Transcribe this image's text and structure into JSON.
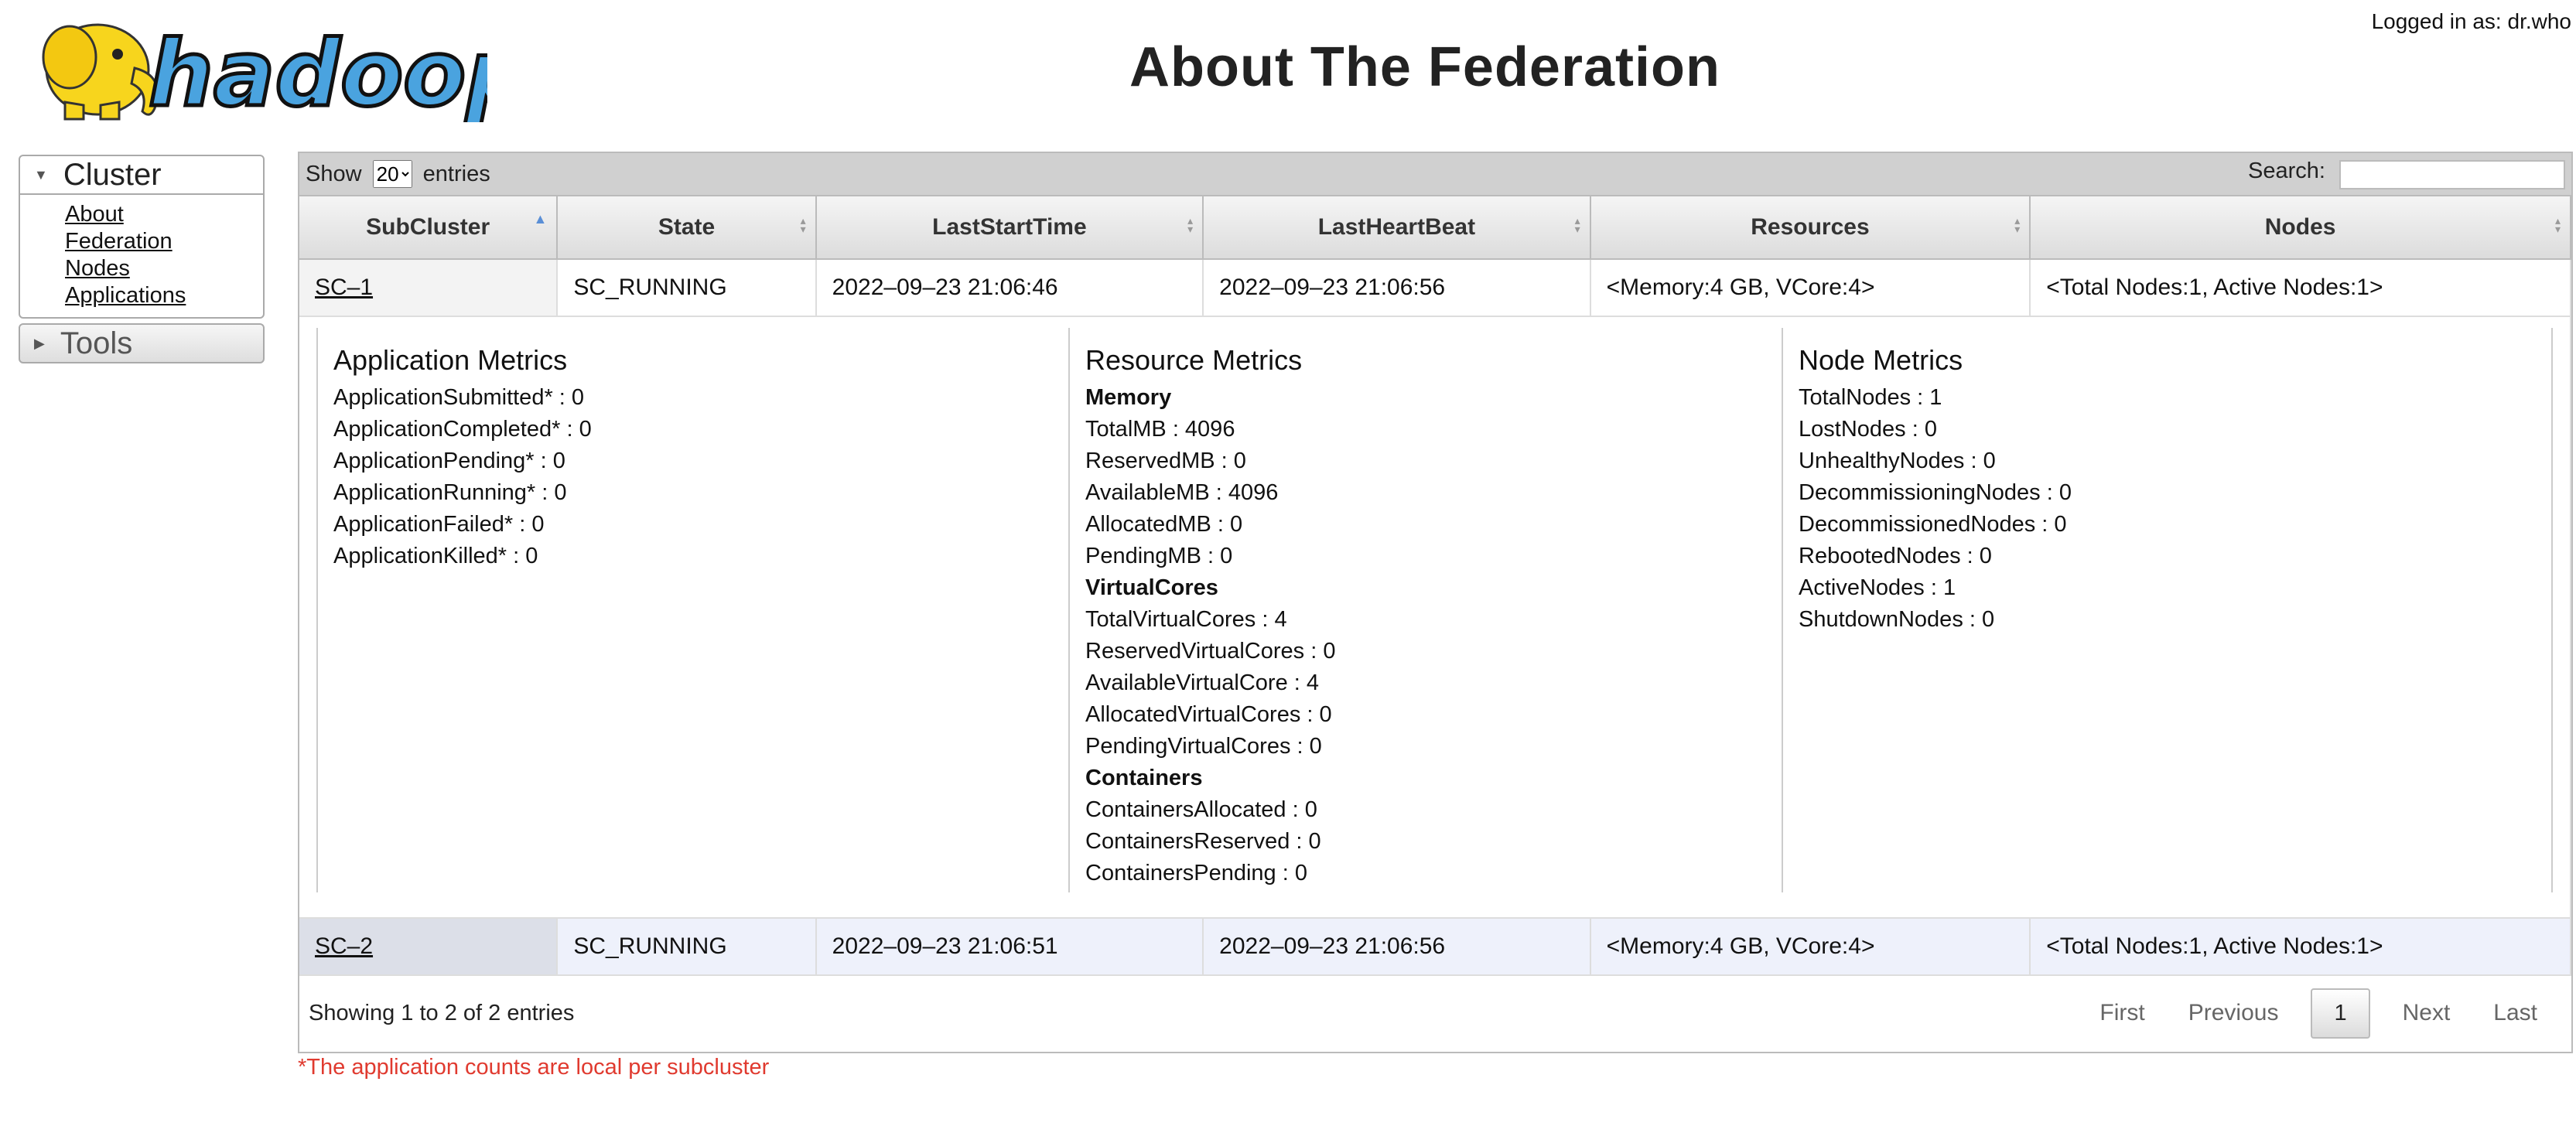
{
  "header": {
    "logo_text": "hadoop",
    "page_title": "About The Federation",
    "logged_in": "Logged in as: dr.who"
  },
  "nav": {
    "cluster_label": "Cluster",
    "links": [
      "About",
      "Federation",
      "Nodes",
      "Applications"
    ],
    "tools_label": "Tools"
  },
  "table": {
    "show_label": "Show",
    "page_size": "20",
    "entries_label": "entries",
    "search_label": "Search:",
    "columns": [
      "SubCluster",
      "State",
      "LastStartTime",
      "LastHeartBeat",
      "Resources",
      "Nodes"
    ],
    "rows": [
      [
        "SC–1",
        "SC_RUNNING",
        "2022–09–23 21:06:46",
        "2022–09–23 21:06:56",
        "<Memory:4 GB, VCore:4>",
        "<Total Nodes:1, Active Nodes:1>"
      ],
      [
        "SC–2",
        "SC_RUNNING",
        "2022–09–23 21:06:51",
        "2022–09–23 21:06:56",
        "<Memory:4 GB, VCore:4>",
        "<Total Nodes:1, Active Nodes:1>"
      ]
    ]
  },
  "details": {
    "application": {
      "title": "Application Metrics",
      "items": [
        "ApplicationSubmitted* : 0",
        "ApplicationCompleted* : 0",
        "ApplicationPending* : 0",
        "ApplicationRunning* : 0",
        "ApplicationFailed* : 0",
        "ApplicationKilled* : 0"
      ]
    },
    "resource": {
      "title": "Resource Metrics",
      "memory_label": "Memory",
      "memory": [
        "TotalMB : 4096",
        "ReservedMB : 0",
        "AvailableMB : 4096",
        "AllocatedMB : 0",
        "PendingMB : 0"
      ],
      "vcores_label": "VirtualCores",
      "vcores": [
        "TotalVirtualCores : 4",
        "ReservedVirtualCores : 0",
        "AvailableVirtualCore : 4",
        "AllocatedVirtualCores : 0",
        "PendingVirtualCores : 0"
      ],
      "containers_label": "Containers",
      "containers": [
        "ContainersAllocated : 0",
        "ContainersReserved : 0",
        "ContainersPending : 0"
      ]
    },
    "node": {
      "title": "Node Metrics",
      "items": [
        "TotalNodes : 1",
        "LostNodes : 0",
        "UnhealthyNodes : 0",
        "DecommissioningNodes : 0",
        "DecommissionedNodes : 0",
        "RebootedNodes : 0",
        "ActiveNodes : 1",
        "ShutdownNodes : 0"
      ]
    }
  },
  "footer": {
    "info": "Showing 1 to 2 of 2 entries",
    "first": "First",
    "previous": "Previous",
    "page": "1",
    "next": "Next",
    "last": "Last"
  },
  "note": "*The application counts are local per subcluster",
  "colors": {
    "accent": "#5a8fd6",
    "note": "#e03a2f",
    "logo_yellow": "#f7d51d",
    "logo_blue": "#4aa3df"
  },
  "icons": {
    "logo": "hadoop-elephant-logo",
    "sort": "sort-arrows-icon",
    "expand": "triangle-down-icon",
    "collapse": "triangle-right-icon"
  }
}
